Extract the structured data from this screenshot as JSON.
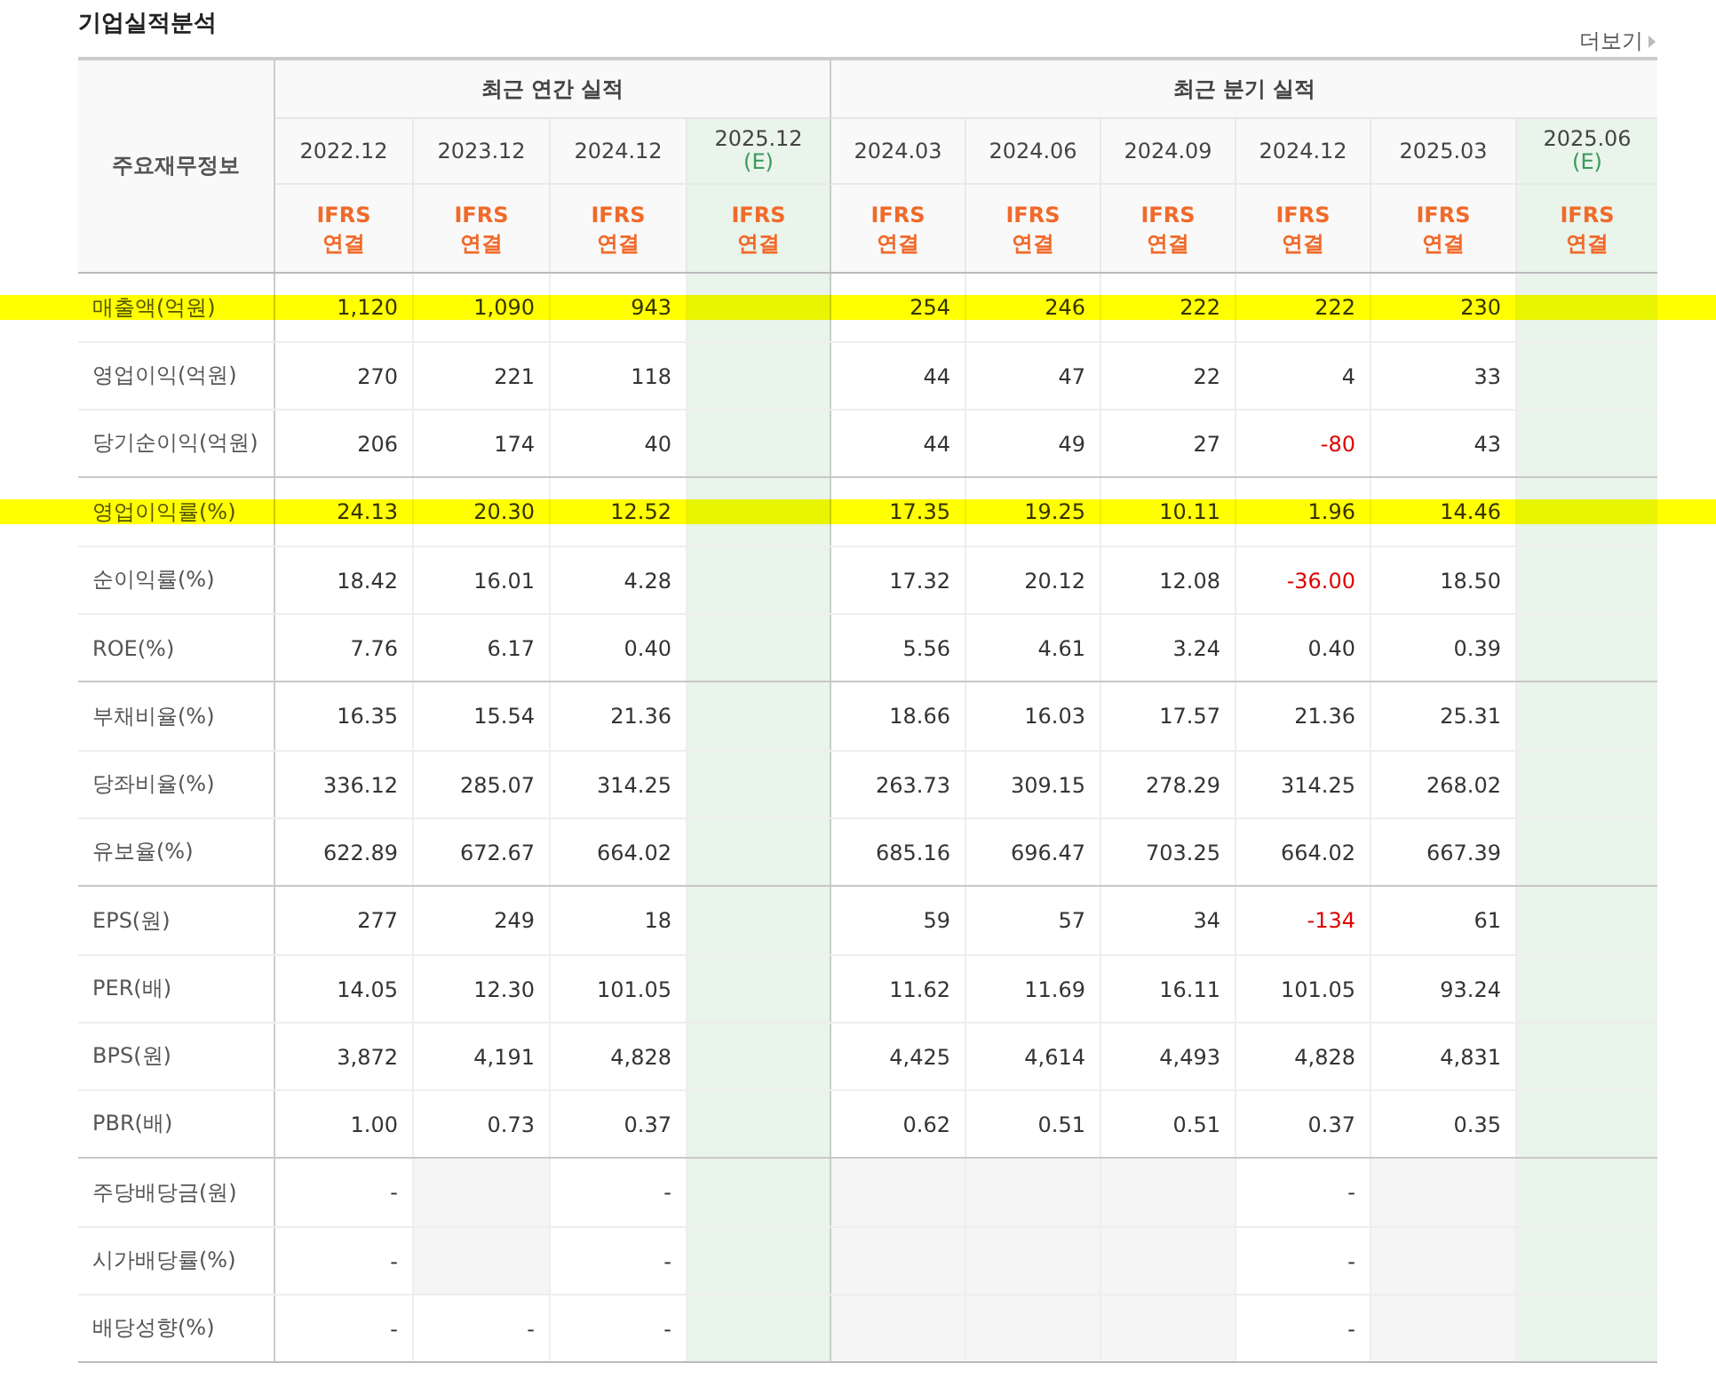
{
  "title": "기업실적분석",
  "more_link": "더보기",
  "table": {
    "corner": "주요재무정보",
    "groups": [
      {
        "label": "최근 연간 실적",
        "columns": [
          {
            "period": "2022.12",
            "estimate": false,
            "basis": "IFRS",
            "scope": "연결"
          },
          {
            "period": "2023.12",
            "estimate": false,
            "basis": "IFRS",
            "scope": "연결"
          },
          {
            "period": "2024.12",
            "estimate": false,
            "basis": "IFRS",
            "scope": "연결"
          },
          {
            "period": "2025.12",
            "estimate": true,
            "estimate_mark": "(E)",
            "basis": "IFRS",
            "scope": "연결"
          }
        ]
      },
      {
        "label": "최근 분기 실적",
        "columns": [
          {
            "period": "2024.03",
            "estimate": false,
            "basis": "IFRS",
            "scope": "연결"
          },
          {
            "period": "2024.06",
            "estimate": false,
            "basis": "IFRS",
            "scope": "연결"
          },
          {
            "period": "2024.09",
            "estimate": false,
            "basis": "IFRS",
            "scope": "연결"
          },
          {
            "period": "2024.12",
            "estimate": false,
            "basis": "IFRS",
            "scope": "연결"
          },
          {
            "period": "2025.03",
            "estimate": false,
            "basis": "IFRS",
            "scope": "연결"
          },
          {
            "period": "2025.06",
            "estimate": true,
            "estimate_mark": "(E)",
            "basis": "IFRS",
            "scope": "연결"
          }
        ]
      }
    ],
    "sections": [
      {
        "rows": [
          {
            "label": "매출액(억원)",
            "highlighted": true,
            "values": [
              {
                "kind": "value",
                "text": "1,120"
              },
              {
                "kind": "value",
                "text": "1,090"
              },
              {
                "kind": "value",
                "text": "943"
              },
              {
                "kind": "blank"
              },
              {
                "kind": "value",
                "text": "254"
              },
              {
                "kind": "value",
                "text": "246"
              },
              {
                "kind": "value",
                "text": "222"
              },
              {
                "kind": "value",
                "text": "222"
              },
              {
                "kind": "value",
                "text": "230"
              },
              {
                "kind": "blank"
              }
            ]
          },
          {
            "label": "영업이익(억원)",
            "highlighted": false,
            "values": [
              {
                "kind": "value",
                "text": "270"
              },
              {
                "kind": "value",
                "text": "221"
              },
              {
                "kind": "value",
                "text": "118"
              },
              {
                "kind": "blank"
              },
              {
                "kind": "value",
                "text": "44"
              },
              {
                "kind": "value",
                "text": "47"
              },
              {
                "kind": "value",
                "text": "22"
              },
              {
                "kind": "value",
                "text": "4"
              },
              {
                "kind": "value",
                "text": "33"
              },
              {
                "kind": "blank"
              }
            ]
          },
          {
            "label": "당기순이익(억원)",
            "highlighted": false,
            "values": [
              {
                "kind": "value",
                "text": "206"
              },
              {
                "kind": "value",
                "text": "174"
              },
              {
                "kind": "value",
                "text": "40"
              },
              {
                "kind": "blank"
              },
              {
                "kind": "value",
                "text": "44"
              },
              {
                "kind": "value",
                "text": "49"
              },
              {
                "kind": "value",
                "text": "27"
              },
              {
                "kind": "value",
                "text": "-80",
                "negative": true
              },
              {
                "kind": "value",
                "text": "43"
              },
              {
                "kind": "blank"
              }
            ]
          }
        ]
      },
      {
        "rows": [
          {
            "label": "영업이익률(%)",
            "highlighted": true,
            "values": [
              {
                "kind": "value",
                "text": "24.13"
              },
              {
                "kind": "value",
                "text": "20.30"
              },
              {
                "kind": "value",
                "text": "12.52"
              },
              {
                "kind": "blank"
              },
              {
                "kind": "value",
                "text": "17.35"
              },
              {
                "kind": "value",
                "text": "19.25"
              },
              {
                "kind": "value",
                "text": "10.11"
              },
              {
                "kind": "value",
                "text": "1.96"
              },
              {
                "kind": "value",
                "text": "14.46"
              },
              {
                "kind": "blank"
              }
            ]
          },
          {
            "label": "순이익률(%)",
            "highlighted": false,
            "values": [
              {
                "kind": "value",
                "text": "18.42"
              },
              {
                "kind": "value",
                "text": "16.01"
              },
              {
                "kind": "value",
                "text": "4.28"
              },
              {
                "kind": "blank"
              },
              {
                "kind": "value",
                "text": "17.32"
              },
              {
                "kind": "value",
                "text": "20.12"
              },
              {
                "kind": "value",
                "text": "12.08"
              },
              {
                "kind": "value",
                "text": "-36.00",
                "negative": true
              },
              {
                "kind": "value",
                "text": "18.50"
              },
              {
                "kind": "blank"
              }
            ]
          },
          {
            "label": "ROE(%)",
            "highlighted": false,
            "values": [
              {
                "kind": "value",
                "text": "7.76"
              },
              {
                "kind": "value",
                "text": "6.17"
              },
              {
                "kind": "value",
                "text": "0.40"
              },
              {
                "kind": "blank"
              },
              {
                "kind": "value",
                "text": "5.56"
              },
              {
                "kind": "value",
                "text": "4.61"
              },
              {
                "kind": "value",
                "text": "3.24"
              },
              {
                "kind": "value",
                "text": "0.40"
              },
              {
                "kind": "value",
                "text": "0.39"
              },
              {
                "kind": "blank"
              }
            ]
          }
        ]
      },
      {
        "rows": [
          {
            "label": "부채비율(%)",
            "highlighted": false,
            "values": [
              {
                "kind": "value",
                "text": "16.35"
              },
              {
                "kind": "value",
                "text": "15.54"
              },
              {
                "kind": "value",
                "text": "21.36"
              },
              {
                "kind": "blank"
              },
              {
                "kind": "value",
                "text": "18.66"
              },
              {
                "kind": "value",
                "text": "16.03"
              },
              {
                "kind": "value",
                "text": "17.57"
              },
              {
                "kind": "value",
                "text": "21.36"
              },
              {
                "kind": "value",
                "text": "25.31"
              },
              {
                "kind": "blank"
              }
            ]
          },
          {
            "label": "당좌비율(%)",
            "highlighted": false,
            "values": [
              {
                "kind": "value",
                "text": "336.12"
              },
              {
                "kind": "value",
                "text": "285.07"
              },
              {
                "kind": "value",
                "text": "314.25"
              },
              {
                "kind": "blank"
              },
              {
                "kind": "value",
                "text": "263.73"
              },
              {
                "kind": "value",
                "text": "309.15"
              },
              {
                "kind": "value",
                "text": "278.29"
              },
              {
                "kind": "value",
                "text": "314.25"
              },
              {
                "kind": "value",
                "text": "268.02"
              },
              {
                "kind": "blank"
              }
            ]
          },
          {
            "label": "유보율(%)",
            "highlighted": false,
            "values": [
              {
                "kind": "value",
                "text": "622.89"
              },
              {
                "kind": "value",
                "text": "672.67"
              },
              {
                "kind": "value",
                "text": "664.02"
              },
              {
                "kind": "blank"
              },
              {
                "kind": "value",
                "text": "685.16"
              },
              {
                "kind": "value",
                "text": "696.47"
              },
              {
                "kind": "value",
                "text": "703.25"
              },
              {
                "kind": "value",
                "text": "664.02"
              },
              {
                "kind": "value",
                "text": "667.39"
              },
              {
                "kind": "blank"
              }
            ]
          }
        ]
      },
      {
        "rows": [
          {
            "label": "EPS(원)",
            "highlighted": false,
            "values": [
              {
                "kind": "value",
                "text": "277"
              },
              {
                "kind": "value",
                "text": "249"
              },
              {
                "kind": "value",
                "text": "18"
              },
              {
                "kind": "blank"
              },
              {
                "kind": "value",
                "text": "59"
              },
              {
                "kind": "value",
                "text": "57"
              },
              {
                "kind": "value",
                "text": "34"
              },
              {
                "kind": "value",
                "text": "-134",
                "negative": true
              },
              {
                "kind": "value",
                "text": "61"
              },
              {
                "kind": "blank"
              }
            ]
          },
          {
            "label": "PER(배)",
            "highlighted": false,
            "values": [
              {
                "kind": "value",
                "text": "14.05"
              },
              {
                "kind": "value",
                "text": "12.30"
              },
              {
                "kind": "value",
                "text": "101.05"
              },
              {
                "kind": "blank"
              },
              {
                "kind": "value",
                "text": "11.62"
              },
              {
                "kind": "value",
                "text": "11.69"
              },
              {
                "kind": "value",
                "text": "16.11"
              },
              {
                "kind": "value",
                "text": "101.05"
              },
              {
                "kind": "value",
                "text": "93.24"
              },
              {
                "kind": "blank"
              }
            ]
          },
          {
            "label": "BPS(원)",
            "highlighted": false,
            "values": [
              {
                "kind": "value",
                "text": "3,872"
              },
              {
                "kind": "value",
                "text": "4,191"
              },
              {
                "kind": "value",
                "text": "4,828"
              },
              {
                "kind": "blank"
              },
              {
                "kind": "value",
                "text": "4,425"
              },
              {
                "kind": "value",
                "text": "4,614"
              },
              {
                "kind": "value",
                "text": "4,493"
              },
              {
                "kind": "value",
                "text": "4,828"
              },
              {
                "kind": "value",
                "text": "4,831"
              },
              {
                "kind": "blank"
              }
            ]
          },
          {
            "label": "PBR(배)",
            "highlighted": false,
            "values": [
              {
                "kind": "value",
                "text": "1.00"
              },
              {
                "kind": "value",
                "text": "0.73"
              },
              {
                "kind": "value",
                "text": "0.37"
              },
              {
                "kind": "blank"
              },
              {
                "kind": "value",
                "text": "0.62"
              },
              {
                "kind": "value",
                "text": "0.51"
              },
              {
                "kind": "value",
                "text": "0.51"
              },
              {
                "kind": "value",
                "text": "0.37"
              },
              {
                "kind": "value",
                "text": "0.35"
              },
              {
                "kind": "blank"
              }
            ]
          }
        ]
      },
      {
        "rows": [
          {
            "label": "주당배당금(원)",
            "highlighted": false,
            "values": [
              {
                "kind": "value",
                "text": "-"
              },
              {
                "kind": "blank"
              },
              {
                "kind": "value",
                "text": "-"
              },
              {
                "kind": "blank"
              },
              {
                "kind": "blank"
              },
              {
                "kind": "blank"
              },
              {
                "kind": "blank"
              },
              {
                "kind": "value",
                "text": "-"
              },
              {
                "kind": "blank"
              },
              {
                "kind": "blank"
              }
            ]
          },
          {
            "label": "시가배당률(%)",
            "highlighted": false,
            "values": [
              {
                "kind": "value",
                "text": "-"
              },
              {
                "kind": "blank"
              },
              {
                "kind": "value",
                "text": "-"
              },
              {
                "kind": "blank"
              },
              {
                "kind": "blank"
              },
              {
                "kind": "blank"
              },
              {
                "kind": "blank"
              },
              {
                "kind": "value",
                "text": "-"
              },
              {
                "kind": "blank"
              },
              {
                "kind": "blank"
              }
            ]
          },
          {
            "label": "배당성향(%)",
            "highlighted": false,
            "values": [
              {
                "kind": "value",
                "text": "-"
              },
              {
                "kind": "value",
                "text": "-"
              },
              {
                "kind": "value",
                "text": "-"
              },
              {
                "kind": "blank"
              },
              {
                "kind": "blank"
              },
              {
                "kind": "blank"
              },
              {
                "kind": "blank"
              },
              {
                "kind": "value",
                "text": "-"
              },
              {
                "kind": "blank"
              },
              {
                "kind": "blank"
              }
            ]
          }
        ]
      }
    ]
  }
}
